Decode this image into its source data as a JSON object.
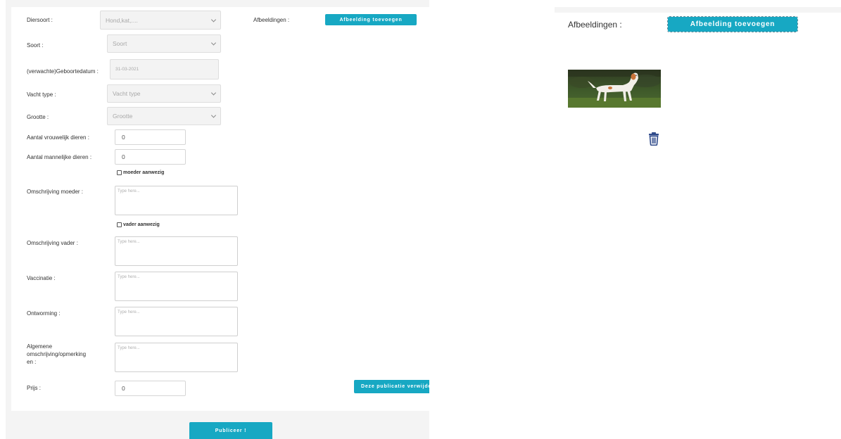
{
  "form": {
    "diersoort": {
      "label": "Diersoort :",
      "value": "Hond,kat,...."
    },
    "soort": {
      "label": "Soort :",
      "value": "Soort"
    },
    "geboortedatum": {
      "label": "(verwachte)Geboortedatum :",
      "value": "31-03-2021"
    },
    "vacht_type": {
      "label": "Vacht type :",
      "value": "Vacht type"
    },
    "grootte": {
      "label": "Grootte :",
      "value": "Grootte"
    },
    "aantal_vrouwelijk": {
      "label": "Aantal vrouwelijk dieren :",
      "value": "0"
    },
    "aantal_mannelijk": {
      "label": "Aantal mannelijke dieren :",
      "value": "0"
    },
    "moeder_aanwezig": {
      "label": "moeder aanwezig",
      "checked": false
    },
    "omschrijving_moeder": {
      "label": "Omschrijving moeder :",
      "placeholder": "Type here..."
    },
    "vader_aanwezig": {
      "label": "vader aanwezig",
      "checked": false
    },
    "omschrijving_vader": {
      "label": "Omschrijving vader :",
      "placeholder": "Type here..."
    },
    "vaccinatie": {
      "label": "Vaccinatie :",
      "placeholder": "Type here..."
    },
    "ontworming": {
      "label": "Ontworming :",
      "placeholder": "Type here..."
    },
    "algemene": {
      "label_lines": [
        "Algemene",
        "omschrijving/opmerking",
        "en :"
      ],
      "placeholder": "Type here..."
    },
    "prijs": {
      "label": "Prijs :",
      "value": "0"
    }
  },
  "images_section": {
    "label": "Afbeeldingen :",
    "add_button": "Afbeelding toevoegen"
  },
  "delete_button": "Deze publicatie verwijderen",
  "publish_button": "Publiceer !",
  "right_panel": {
    "label": "Afbeeldingen :",
    "add_button": "Afbeelding toevoegen",
    "icons": {
      "delete": "trash-icon"
    }
  },
  "colors": {
    "accent": "#17a8c3",
    "background": "#f4f4f4",
    "trash_icon": "#2f4a8a"
  }
}
